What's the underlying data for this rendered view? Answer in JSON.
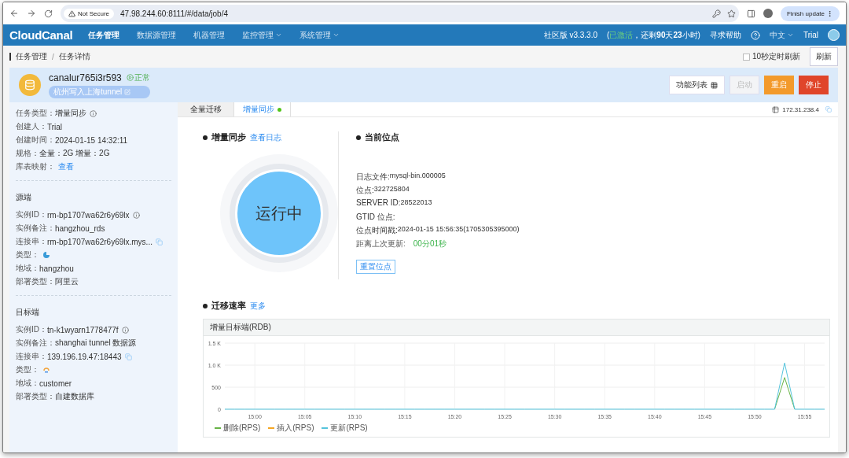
{
  "browser": {
    "security": "Not Secure",
    "url": "47.98.244.60:8111/#/data/job/4",
    "update_button": "Finish update"
  },
  "app_header": {
    "logo": "CloudCanal",
    "nav": [
      {
        "label": "任务管理",
        "selected": true,
        "dropdown": false
      },
      {
        "label": "数据源管理",
        "selected": false,
        "dropdown": false
      },
      {
        "label": "机器管理",
        "selected": false,
        "dropdown": false
      },
      {
        "label": "监控管理",
        "selected": false,
        "dropdown": true
      },
      {
        "label": "系统管理",
        "selected": false,
        "dropdown": true
      }
    ],
    "edition": "社区版 v3.3.3.0",
    "license_open": "(",
    "license_status": "已激活",
    "license_rest": "，还剩**90**天**23**小时)",
    "help": "寻求帮助",
    "language": "中文",
    "user": "Trial"
  },
  "breadcrumb": [
    "任务管理",
    "任务详情"
  ],
  "breadcrumb_separator": "/",
  "auto_refresh": {
    "label": "10秒定时刷新",
    "checked": false
  },
  "refresh_button": "刷新",
  "job": {
    "name": "canalur765i3r593",
    "status": "正常",
    "description": "杭州写入上海tunnel",
    "actions": [
      {
        "label": "功能列表",
        "kind": "menu",
        "disabled": false
      },
      {
        "label": "启动",
        "kind": "default",
        "disabled": true
      },
      {
        "label": "重启",
        "kind": "warning",
        "disabled": false
      },
      {
        "label": "停止",
        "kind": "danger",
        "disabled": false
      }
    ]
  },
  "sidebar": {
    "basic": [
      {
        "label": "任务类型：",
        "value": "增量同步",
        "kind": "info"
      },
      {
        "label": "创建人：",
        "value": "Trial",
        "kind": "text"
      },
      {
        "label": "创建时间：",
        "value": "2024-01-15 14:32:11",
        "kind": "text"
      },
      {
        "label": "规格：",
        "value": "全量：2G 增量：2G",
        "kind": "text"
      },
      {
        "label": "库表映射：",
        "value": "查看",
        "kind": "link"
      }
    ],
    "sections": [
      {
        "title": "源端",
        "fields": [
          {
            "label": "实例ID：",
            "value": "rm-bp1707wa62r6y69lx",
            "kind": "info"
          },
          {
            "label": "实例备注：",
            "value": "hangzhou_rds",
            "kind": "text"
          },
          {
            "label": "连接串：",
            "value": "rm-bp1707wa62r6y69lx.mys...",
            "kind": "copy"
          },
          {
            "label": "类型：",
            "kind": "mysql"
          },
          {
            "label": "地域：",
            "value": "hangzhou",
            "kind": "text"
          },
          {
            "label": "部署类型：",
            "value": "阿里云",
            "kind": "text"
          }
        ]
      },
      {
        "title": "目标端",
        "fields": [
          {
            "label": "实例ID：",
            "value": "tn-k1wyarn1778477f",
            "kind": "info"
          },
          {
            "label": "实例备注：",
            "value": "shanghai tunnel 数据源",
            "kind": "text"
          },
          {
            "label": "连接串：",
            "value": "139.196.19.47:18443",
            "kind": "copy"
          },
          {
            "label": "类型：",
            "kind": "tunnel"
          },
          {
            "label": "地域：",
            "value": "customer",
            "kind": "text"
          },
          {
            "label": "部署类型：",
            "value": "自建数据库",
            "kind": "text"
          }
        ]
      }
    ]
  },
  "tabs": [
    {
      "label": "全量迁移",
      "selected": false,
      "running": false
    },
    {
      "label": "增量同步",
      "selected": true,
      "running": true
    }
  ],
  "server": "172.31.238.4",
  "incremental": {
    "title": "增量同步",
    "link": "查看日志",
    "status": "运行中"
  },
  "position": {
    "title": "当前位点",
    "rows": [
      {
        "label": "日志文件: ",
        "value": "mysql-bin.000005",
        "kind": "text"
      },
      {
        "label": "位点: ",
        "value": "322725804",
        "kind": "text"
      },
      {
        "label": "SERVER ID: ",
        "value": "28522013",
        "kind": "text"
      },
      {
        "label": "GTID 位点: ",
        "kind": "text"
      },
      {
        "label": "位点时间戳: ",
        "value": "2024-01-15 15:56:35(1705305395000)",
        "kind": "text"
      },
      {
        "label": "距离上次更新: ",
        "value": "00分01秒",
        "kind": "fresh"
      }
    ],
    "reset_button": "重置位点"
  },
  "rate": {
    "title": "迁移速率",
    "link": "更多",
    "panel_title": "增量目标端(RDB)",
    "chart_data": {
      "type": "line",
      "categories": [
        null,
        null,
        null,
        "15:00",
        null,
        null,
        null,
        null,
        "15:05",
        null,
        null,
        null,
        null,
        "15:10",
        null,
        null,
        null,
        null,
        "15:15",
        null,
        null,
        null,
        null,
        "15:20",
        null,
        null,
        null,
        null,
        "15:25",
        null,
        null,
        null,
        null,
        "15:30",
        null,
        null,
        null,
        null,
        "15:35",
        null,
        null,
        null,
        null,
        "15:40",
        null,
        null,
        null,
        null,
        "15:45",
        null,
        null,
        null,
        null,
        "15:50",
        null,
        null,
        null,
        null,
        "15:55",
        null,
        null
      ],
      "series": [
        {
          "name": "删除(RPS)",
          "color": "#67b346",
          "values": [
            null,
            null,
            null,
            null,
            null,
            null,
            null,
            null,
            null,
            null,
            null,
            null,
            null,
            null,
            null,
            null,
            null,
            null,
            null,
            null,
            null,
            null,
            null,
            null,
            null,
            null,
            null,
            null,
            null,
            null,
            null,
            null,
            null,
            null,
            null,
            null,
            null,
            null,
            null,
            null,
            null,
            null,
            null,
            null,
            null,
            null,
            null,
            null,
            null,
            null,
            null,
            null,
            null,
            null,
            null,
            0,
            720,
            0,
            null,
            null,
            null
          ]
        },
        {
          "name": "插入(RPS)",
          "color": "#f5a623",
          "values": [
            null,
            null,
            null,
            null,
            null,
            null,
            null,
            null,
            null,
            null,
            null,
            null,
            null,
            null,
            null,
            null,
            null,
            null,
            null,
            null,
            null,
            null,
            null,
            null,
            null,
            null,
            null,
            null,
            null,
            null,
            null,
            null,
            null,
            null,
            null,
            null,
            null,
            null,
            null,
            null,
            null,
            null,
            null,
            null,
            null,
            null,
            null,
            null,
            null,
            null,
            null,
            null,
            null,
            null,
            null,
            null,
            null,
            null,
            null,
            null,
            null
          ]
        },
        {
          "name": "更新(RPS)",
          "color": "#55c4dc",
          "values": [
            0,
            0,
            0,
            0,
            0,
            0,
            0,
            0,
            0,
            0,
            0,
            0,
            0,
            0,
            0,
            0,
            0,
            0,
            0,
            0,
            0,
            0,
            0,
            0,
            0,
            0,
            0,
            0,
            0,
            0,
            0,
            0,
            0,
            0,
            0,
            0,
            0,
            0,
            0,
            0,
            0,
            0,
            0,
            0,
            0,
            0,
            0,
            0,
            0,
            0,
            0,
            0,
            0,
            0,
            0,
            0,
            1050,
            0,
            0,
            0,
            0
          ]
        }
      ],
      "grid": true,
      "legend": "bottom",
      "ylim": [
        0,
        1500
      ],
      "yticks": [
        0,
        500,
        {
          "value": 1000,
          "label": "1.0 K"
        },
        {
          "value": 1500,
          "label": "1.5 K"
        }
      ]
    }
  }
}
